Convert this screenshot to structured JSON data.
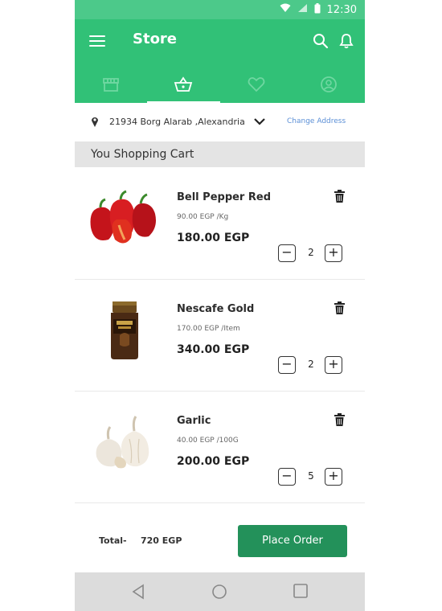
{
  "status_bar": {
    "time": "12:30"
  },
  "app_bar": {
    "title": "Store",
    "tabs": [
      {
        "icon": "store-icon",
        "active": false
      },
      {
        "icon": "basket-icon",
        "active": true
      },
      {
        "icon": "heart-icon",
        "active": false
      },
      {
        "icon": "profile-icon",
        "active": false
      }
    ]
  },
  "address": {
    "text": "21934  Borg Alarab ,Alexandria",
    "change_label": "Change Address"
  },
  "cart": {
    "heading": "You Shopping Cart",
    "items": [
      {
        "name": "Bell Pepper Red",
        "unit_price": "90.00 EGP /Kg",
        "total": "180.00 EGP",
        "quantity": "2",
        "image": "red-bell-peppers"
      },
      {
        "name": "Nescafe Gold",
        "unit_price": "170.00 EGP /Item",
        "total": "340.00 EGP",
        "quantity": "2",
        "image": "nescafe-gold-jar"
      },
      {
        "name": "Garlic",
        "unit_price": "40.00 EGP /100G",
        "total": "200.00 EGP",
        "quantity": "5",
        "image": "garlic-bulbs"
      }
    ]
  },
  "footer": {
    "total_label": "Total-",
    "total_value": "720 EGP",
    "order_button": "Place Order"
  },
  "colors": {
    "primary": "#31c177",
    "status_bar": "#4cc98a",
    "order_button": "#23915a",
    "link": "#5b8fd6"
  }
}
